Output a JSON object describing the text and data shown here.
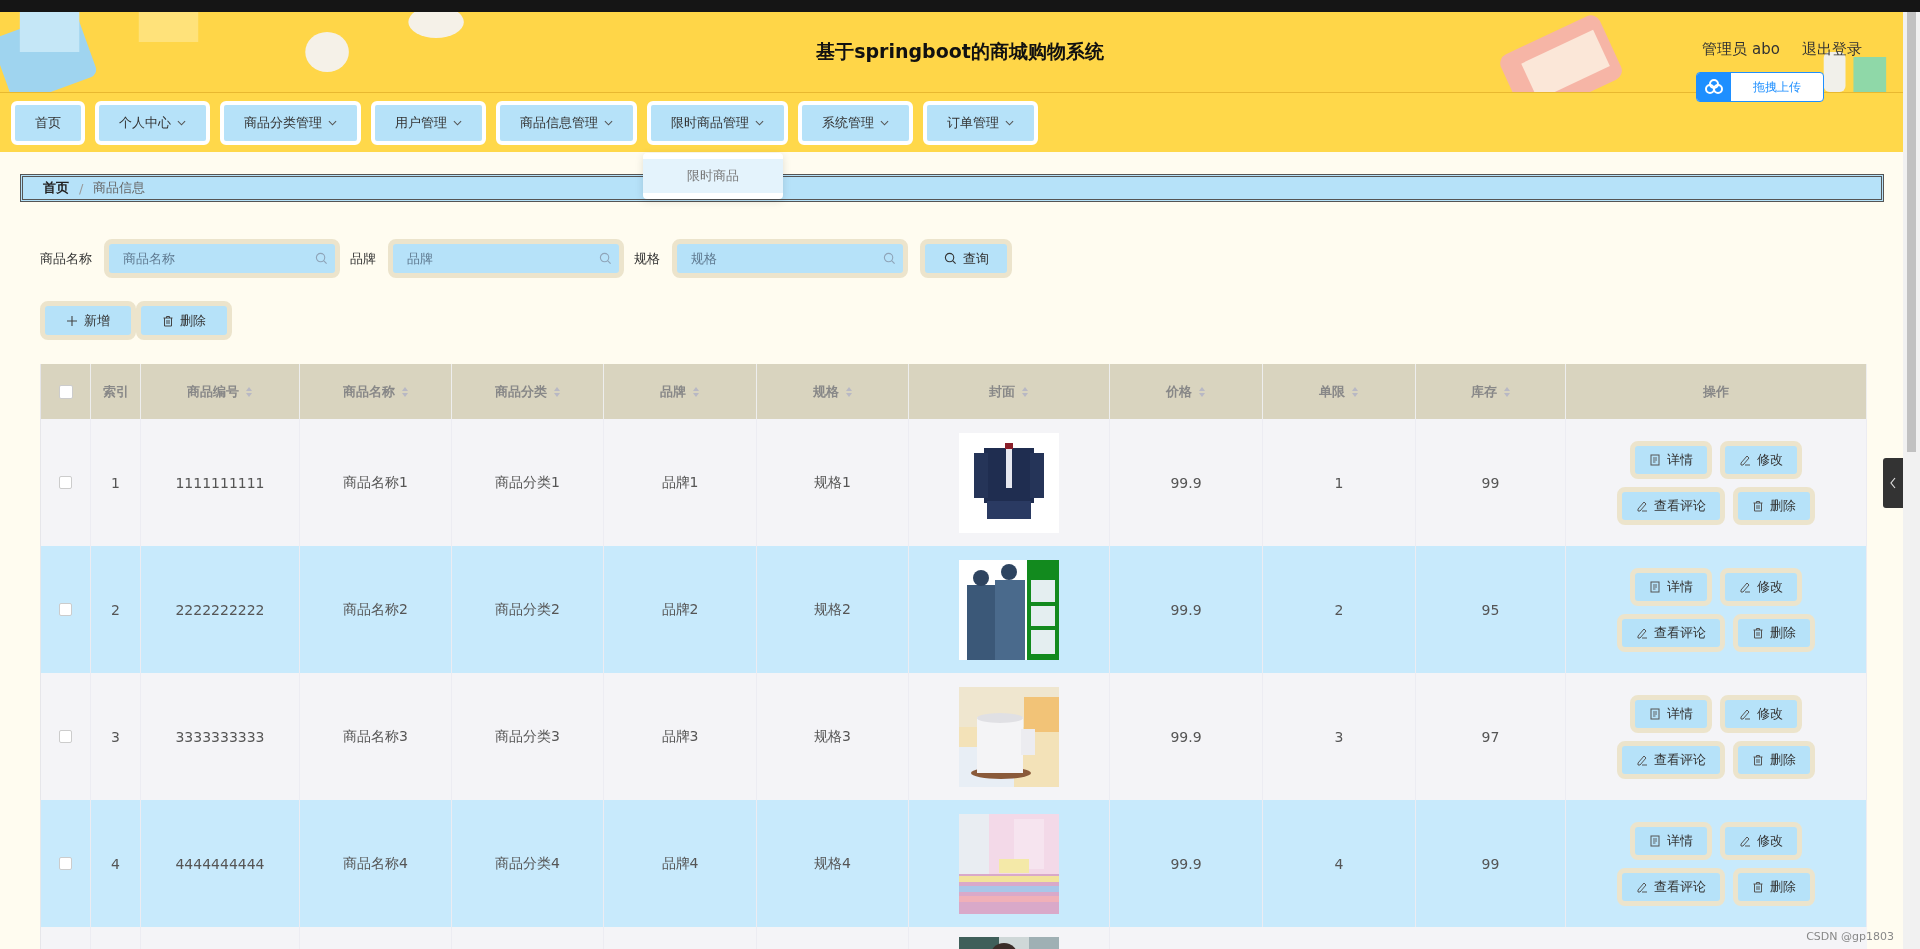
{
  "header": {
    "title": "基于springboot的商城购物系统",
    "user": "管理员 abo",
    "logout": "退出登录",
    "upload_button": "拖拽上传"
  },
  "nav": [
    {
      "label": "首页",
      "dropdown": false
    },
    {
      "label": "个人中心",
      "dropdown": true
    },
    {
      "label": "商品分类管理",
      "dropdown": true
    },
    {
      "label": "用户管理",
      "dropdown": true
    },
    {
      "label": "商品信息管理",
      "dropdown": true
    },
    {
      "label": "限时商品管理",
      "dropdown": true,
      "menu": [
        "限时商品"
      ]
    },
    {
      "label": "系统管理",
      "dropdown": true
    },
    {
      "label": "订单管理",
      "dropdown": true
    }
  ],
  "breadcrumb": {
    "items": [
      "首页",
      "商品信息"
    ],
    "separator": "/"
  },
  "search": {
    "fields": [
      {
        "label": "商品名称",
        "placeholder": "商品名称"
      },
      {
        "label": "品牌",
        "placeholder": "品牌"
      },
      {
        "label": "规格",
        "placeholder": "规格"
      }
    ],
    "button": "查询"
  },
  "toolbar": [
    {
      "label": "新增",
      "kind": "add"
    },
    {
      "label": "删除",
      "kind": "delete"
    }
  ],
  "table": {
    "header_checked": false,
    "columns": [
      {
        "label": "索引",
        "sortable": false
      },
      {
        "label": "商品编号",
        "sortable": true
      },
      {
        "label": "商品名称",
        "sortable": true
      },
      {
        "label": "商品分类",
        "sortable": true
      },
      {
        "label": "品牌",
        "sortable": true
      },
      {
        "label": "规格",
        "sortable": true
      },
      {
        "label": "封面",
        "sortable": true
      },
      {
        "label": "价格",
        "sortable": true
      },
      {
        "label": "单限",
        "sortable": true
      },
      {
        "label": "库存",
        "sortable": true
      },
      {
        "label": "操作",
        "sortable": false
      }
    ],
    "rows": [
      {
        "checked": false,
        "index": "1",
        "code": "1111111111",
        "name": "商品名称1",
        "category": "商品分类1",
        "brand": "品牌1",
        "spec": "规格1",
        "price": "99.9",
        "limit": "1",
        "stock": "99",
        "actions": [
          {
            "label": "详情",
            "kind": "details"
          },
          {
            "label": "修改",
            "kind": "edit"
          },
          {
            "label": "查看评论",
            "kind": "comments"
          },
          {
            "label": "删除",
            "kind": "delete"
          }
        ]
      },
      {
        "checked": false,
        "index": "2",
        "code": "2222222222",
        "name": "商品名称2",
        "category": "商品分类2",
        "brand": "品牌2",
        "spec": "规格2",
        "price": "99.9",
        "limit": "2",
        "stock": "95",
        "actions": [
          {
            "label": "详情",
            "kind": "details"
          },
          {
            "label": "修改",
            "kind": "edit"
          },
          {
            "label": "查看评论",
            "kind": "comments"
          },
          {
            "label": "删除",
            "kind": "delete"
          }
        ]
      },
      {
        "checked": false,
        "index": "3",
        "code": "3333333333",
        "name": "商品名称3",
        "category": "商品分类3",
        "brand": "品牌3",
        "spec": "规格3",
        "price": "99.9",
        "limit": "3",
        "stock": "97",
        "actions": [
          {
            "label": "详情",
            "kind": "details"
          },
          {
            "label": "修改",
            "kind": "edit"
          },
          {
            "label": "查看评论",
            "kind": "comments"
          },
          {
            "label": "删除",
            "kind": "delete"
          }
        ]
      },
      {
        "checked": false,
        "index": "4",
        "code": "4444444444",
        "name": "商品名称4",
        "category": "商品分类4",
        "brand": "品牌4",
        "spec": "规格4",
        "price": "99.9",
        "limit": "4",
        "stock": "99",
        "actions": [
          {
            "label": "详情",
            "kind": "details"
          },
          {
            "label": "修改",
            "kind": "edit"
          },
          {
            "label": "查看评论",
            "kind": "comments"
          },
          {
            "label": "删除",
            "kind": "delete"
          }
        ]
      }
    ]
  },
  "watermark": "CSDN @gp1803"
}
